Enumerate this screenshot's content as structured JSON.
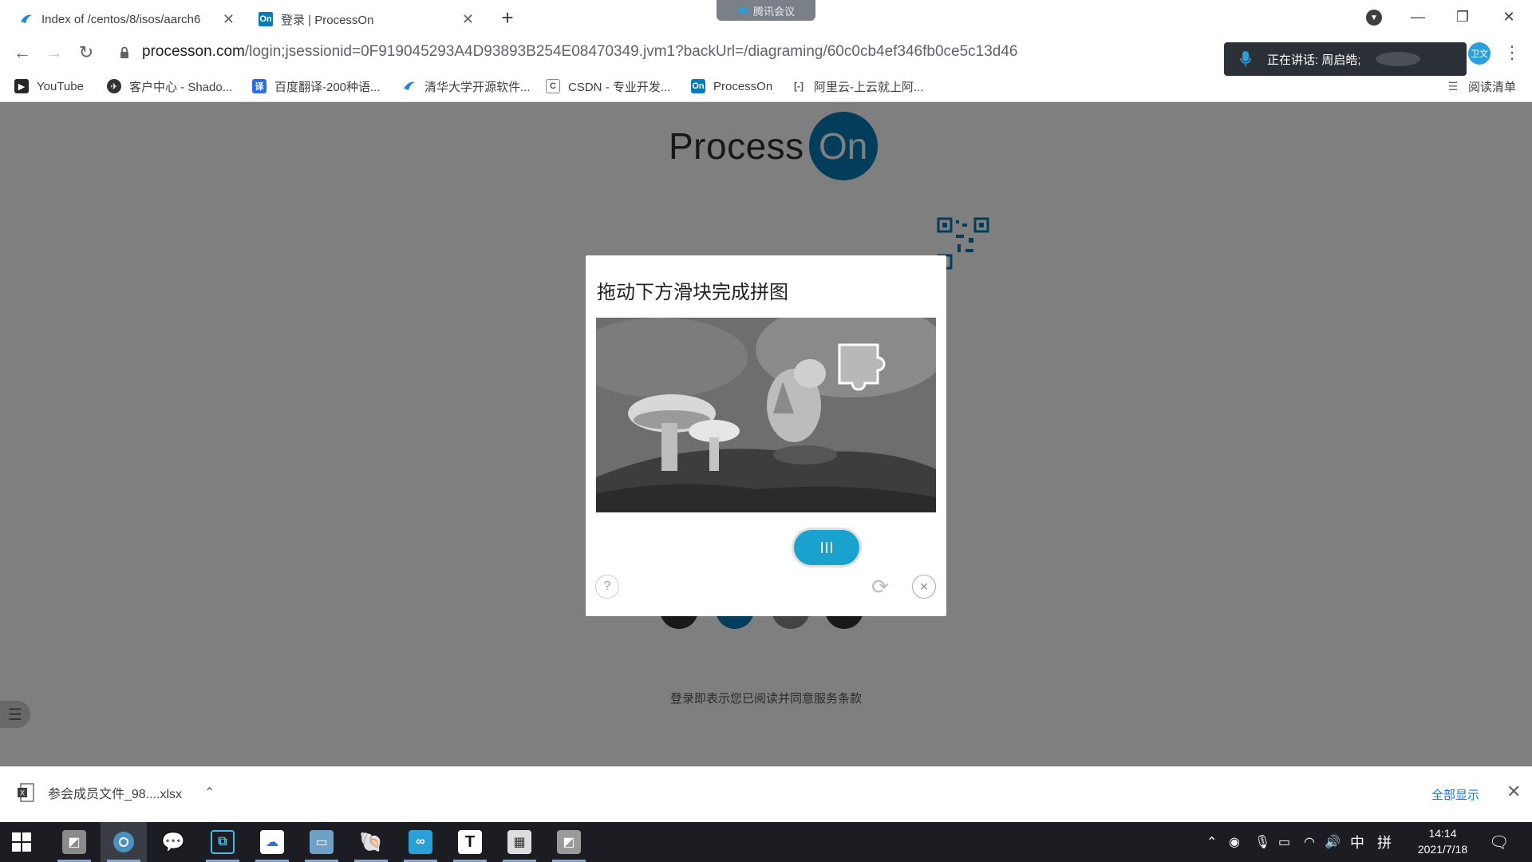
{
  "browser": {
    "tabs": [
      {
        "title": "Index of /centos/8/isos/aarch6",
        "active": false
      },
      {
        "title": "登录 | ProcessOn",
        "active": true
      }
    ],
    "meeting_label": "腾讯会议",
    "url_host": "processon.com",
    "url_path": "/login;jsessionid=0F919045293A4D93893B254E08470349.jvm1?backUrl=/diagraming/60c0cb4ef346fb0ce5c13d46",
    "bookmarks": [
      {
        "label": "YouTube",
        "icon": "youtube-icon",
        "color": "#ff0000"
      },
      {
        "label": "客户中心 - Shado...",
        "icon": "shadowsocks-icon",
        "color": "#333333"
      },
      {
        "label": "百度翻译-200种语...",
        "icon": "baidu-translate-icon",
        "color": "#2b6de8"
      },
      {
        "label": "清华大学开源软件...",
        "icon": "tuna-icon",
        "color": "#1e88e5"
      },
      {
        "label": "CSDN - 专业开发...",
        "icon": "csdn-icon",
        "color": "#c0392b"
      },
      {
        "label": "ProcessOn",
        "icon": "processon-icon",
        "color": "#067bb9"
      },
      {
        "label": "阿里云-上云就上阿...",
        "icon": "aliyun-icon",
        "color": "#ff6a00"
      }
    ],
    "reading_list_label": "阅读清单"
  },
  "meeting": {
    "speaking_label": "正在讲话: 周启皓;",
    "avatar_text": "卫文"
  },
  "page": {
    "logo_text": "Process",
    "logo_badge": "On",
    "terms_text": "登录即表示您已阅读并同意服务条款",
    "brand_color": "#067bb9"
  },
  "captcha": {
    "title": "拖动下方滑块完成拼图",
    "slider_progress": 0.72,
    "help_symbol": "?",
    "refresh_symbol": "⟳",
    "close_symbol": "×"
  },
  "downloads": {
    "file_name": "参会成员文件_98....xlsx",
    "show_all": "全部显示"
  },
  "taskbar": {
    "ime_lang": "中",
    "ime_mode": "拼",
    "time": "14:14",
    "date": "2021/7/18"
  }
}
